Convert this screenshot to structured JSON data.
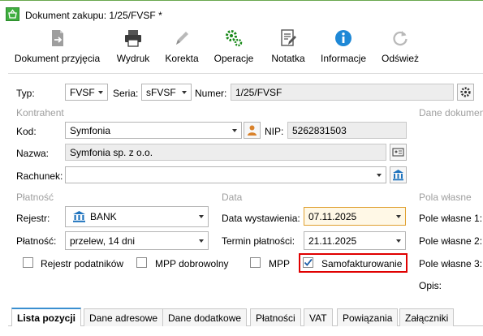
{
  "window": {
    "title": "Dokument zakupu: 1/25/FVSF *"
  },
  "ribbon": {
    "items": [
      {
        "label": "Dokument przyjęcia",
        "icon": "document-receipt-icon"
      },
      {
        "label": "Wydruk",
        "icon": "printer-icon"
      },
      {
        "label": "Korekta",
        "icon": "pencil-icon"
      },
      {
        "label": "Operacje",
        "icon": "gears-icon"
      },
      {
        "label": "Notatka",
        "icon": "note-edit-icon"
      },
      {
        "label": "Informacje",
        "icon": "info-icon"
      },
      {
        "label": "Odśwież",
        "icon": "refresh-icon"
      }
    ]
  },
  "header": {
    "typ_label": "Typ:",
    "typ_value": "FVSF",
    "seria_label": "Seria:",
    "seria_value": "sFVSF",
    "numer_label": "Numer:",
    "numer_value": "1/25/FVSF"
  },
  "kontrahent": {
    "section": "Kontrahent",
    "kod_label": "Kod:",
    "kod_value": "Symfonia",
    "nip_label": "NIP:",
    "nip_value": "5262831503",
    "nazwa_label": "Nazwa:",
    "nazwa_value": "Symfonia sp. z o.o.",
    "rachunek_label": "Rachunek:",
    "rachunek_value": ""
  },
  "dane_dokumentu": {
    "section": "Dane dokumen"
  },
  "platnosc": {
    "section": "Płatność",
    "rejestr_label": "Rejestr:",
    "rejestr_value": "BANK",
    "platnosc_label": "Płatność:",
    "platnosc_value": "przelew, 14 dni"
  },
  "data": {
    "section": "Data",
    "wystawienia_label": "Data wystawienia:",
    "wystawienia_value": "07.11.2025",
    "termin_label": "Termin płatności:",
    "termin_value": "21.11.2025"
  },
  "checkboxes": {
    "rejestr_podatnikow": {
      "label": "Rejestr podatników",
      "checked": false
    },
    "mpp_dobrowolny": {
      "label": "MPP dobrowolny",
      "checked": false
    },
    "mpp": {
      "label": "MPP",
      "checked": false
    },
    "samofakturowanie": {
      "label": "Samofakturowanie",
      "checked": true
    }
  },
  "pola_wlasne": {
    "section": "Pola własne",
    "pole1": "Pole własne 1:",
    "pole2": "Pole własne 2:",
    "pole3": "Pole własne 3:",
    "opis": "Opis:"
  },
  "tabs": [
    {
      "label": "Lista pozycji",
      "active": true
    },
    {
      "label": "Dane adresowe",
      "active": false
    },
    {
      "label": "Dane dodatkowe",
      "active": false
    },
    {
      "label": "Płatności",
      "active": false
    },
    {
      "label": "VAT",
      "active": false
    },
    {
      "label": "Powiązania",
      "active": false
    },
    {
      "label": "Załączniki",
      "active": false
    }
  ],
  "colors": {
    "accent": "#3a8fd0",
    "highlight_border": "#e00000",
    "date_focus": "#e0a030"
  }
}
